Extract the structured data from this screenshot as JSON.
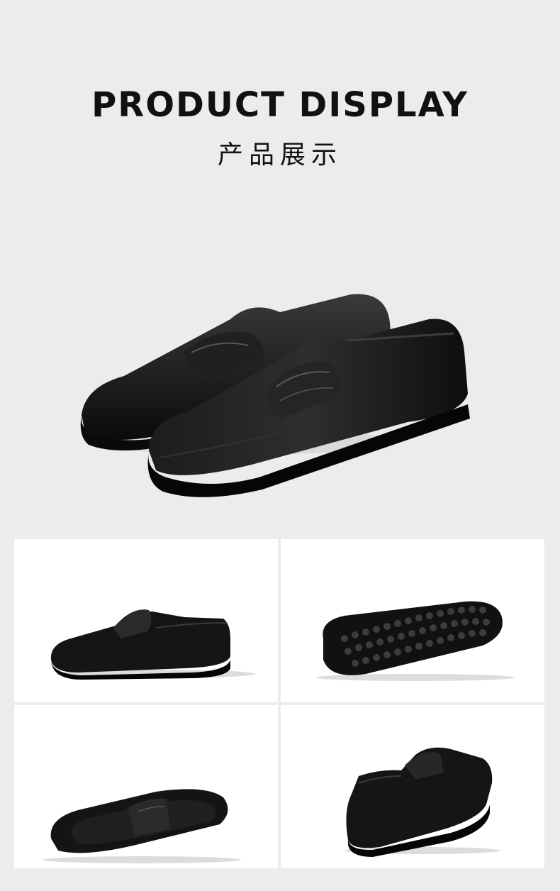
{
  "header": {
    "title_en": "PRODUCT DISPLAY",
    "title_cn": "产品展示"
  },
  "images": {
    "hero": "pair-of-black-leather-penny-loafers",
    "side_view": "black-loafer-side-view",
    "sole_view": "black-loafer-dotted-sole-view",
    "top_view": "black-loafer-top-view",
    "rear_view": "black-loafer-rear-three-quarter-view"
  },
  "colors": {
    "background": "#ececec",
    "panel": "#ffffff",
    "leather": "#121212",
    "text": "#111111"
  }
}
